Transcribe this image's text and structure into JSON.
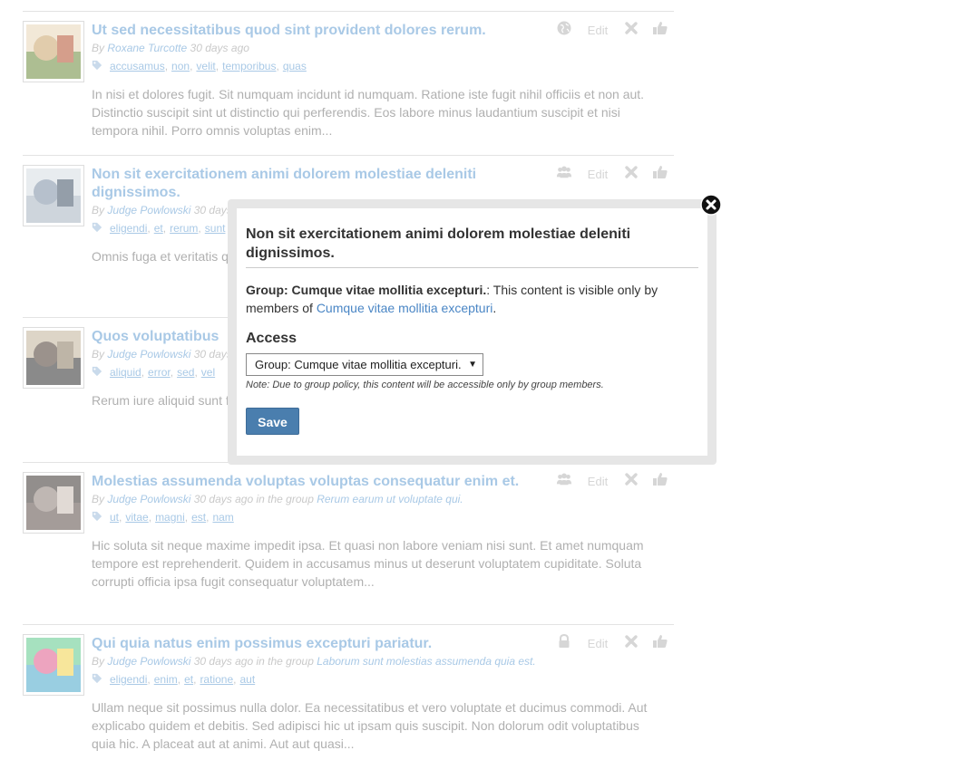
{
  "posts": [
    {
      "title": "Ut sed necessitatibus quod sint provident dolores rerum.",
      "by": "By",
      "author": "Roxane Turcotte",
      "time": "30 days ago",
      "group_prefix": "",
      "group": "",
      "tags": [
        "accusamus",
        "non",
        "velit",
        "temporibus",
        "quas"
      ],
      "excerpt": "In nisi et dolores fugit. Sit numquam incidunt id numquam. Ratione iste fugit nihil officiis et non aut. Distinctio suscipit sint ut distinctio qui perferendis. Eos labore minus laudantium suscipit et nisi tempora nihil. Porro omnis voluptas enim...",
      "access_icon": "globe-icon",
      "edit_label": "Edit"
    },
    {
      "title": "Non sit exercitationem animi dolorem molestiae deleniti dignissimos.",
      "by": "By",
      "author": "Judge Powlowski",
      "time": "30 days ago",
      "group_prefix": "",
      "group": "",
      "tags": [
        "eligendi",
        "et",
        "rerum",
        "sunt"
      ],
      "excerpt": "Omnis fuga et veritatis quis. Voluptas non debitis consequatur. culpa accusantium expedita.",
      "access_icon": "group-icon",
      "edit_label": "Edit"
    },
    {
      "title": "Quos voluptatibus",
      "by": "By",
      "author": "Judge Powlowski",
      "time": "30 days ago",
      "group_prefix": "",
      "group": "",
      "tags": [
        "aliquid",
        "error",
        "sed",
        "vel"
      ],
      "excerpt": "Rerum iure aliquid sunt facilis consectetur. Non excepturi aut. Omnis beatae.",
      "access_icon": "group-icon",
      "edit_label": "Edit"
    },
    {
      "title": "Molestias assumenda voluptas voluptas consequatur enim et.",
      "by": "By",
      "author": "Judge Powlowski",
      "time": "30 days ago",
      "group_prefix": "in the group",
      "group": "Rerum earum ut voluptate qui.",
      "tags": [
        "ut",
        "vitae",
        "magni",
        "est",
        "nam"
      ],
      "excerpt": "Hic soluta sit neque maxime impedit ipsa. Et quasi non labore veniam nisi sunt. Et amet numquam tempore est reprehenderit. Quidem in accusamus minus ut deserunt voluptatem cupiditate. Soluta corrupti officia ipsa fugit consequatur voluptatem...",
      "access_icon": "group-icon",
      "edit_label": "Edit"
    },
    {
      "title": "Qui quia natus enim possimus excepturi pariatur.",
      "by": "By",
      "author": "Judge Powlowski",
      "time": "30 days ago",
      "group_prefix": "in the group",
      "group": "Laborum sunt molestias assumenda quia est.",
      "tags": [
        "eligendi",
        "enim",
        "et",
        "ratione",
        "aut"
      ],
      "excerpt": "Ullam neque sit possimus nulla dolor. Ea necessitatibus et vero voluptate et ducimus commodi. Aut explicabo quidem et debitis. Sed adipisci hic ut ipsam quis suscipit. Non dolorum odit voluptatibus quia hic. A placeat aut at animi. Aut aut quasi...",
      "access_icon": "lock-icon",
      "edit_label": "Edit"
    }
  ],
  "modal": {
    "title": "Non sit exercitationem animi dolorem molestiae deleniti dignissimos.",
    "visibility_strong": "Group: Cumque vitae mollitia excepturi.",
    "visibility_text": ": This content is visible only by members of ",
    "visibility_link": "Cumque vitae mollitia excepturi",
    "visibility_end": ".",
    "access_label": "Access",
    "access_value": "Group: Cumque vitae mollitia excepturi.",
    "note": "Note: Due to group policy, this content will be accessible only by group members.",
    "save_label": "Save"
  },
  "colors": {
    "link_faded": "#a9c9e6",
    "link": "#4a86c5",
    "button": "#4a7eae"
  }
}
